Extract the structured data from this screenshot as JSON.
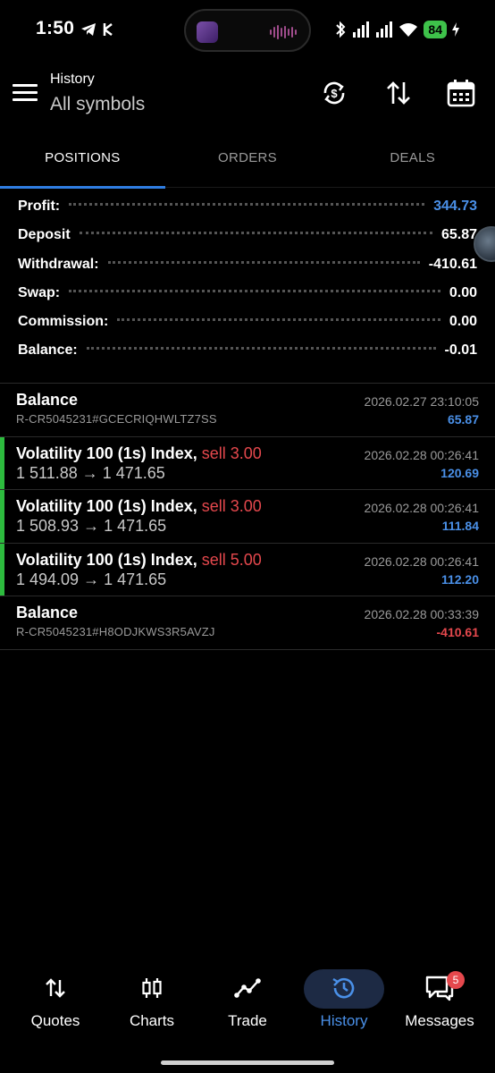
{
  "status_bar": {
    "time": "1:50",
    "battery": "84",
    "icons": [
      "telegram-icon",
      "app-notification-icon",
      "bluetooth-icon",
      "signal-icon",
      "signal-icon",
      "wifi-icon",
      "charging-icon"
    ]
  },
  "header": {
    "title": "History",
    "subtitle": "All symbols",
    "actions": [
      "currency-refresh-icon",
      "sort-icon",
      "calendar-icon"
    ]
  },
  "tabs": [
    {
      "label": "POSITIONS",
      "active": true
    },
    {
      "label": "ORDERS",
      "active": false
    },
    {
      "label": "DEALS",
      "active": false
    }
  ],
  "summary": [
    {
      "label": "Profit:",
      "value": "344.73",
      "color": "#4a90e8"
    },
    {
      "label": "Deposit",
      "value": "65.87",
      "color": "#ffffff"
    },
    {
      "label": "Withdrawal:",
      "value": "-410.61",
      "color": "#ffffff"
    },
    {
      "label": "Swap:",
      "value": "0.00",
      "color": "#ffffff"
    },
    {
      "label": "Commission:",
      "value": "0.00",
      "color": "#ffffff"
    },
    {
      "label": "Balance:",
      "value": "-0.01",
      "color": "#ffffff"
    }
  ],
  "history": [
    {
      "type": "balance",
      "title": "Balance",
      "sub": "R-CR5045231#GCECRIQHWLTZ7SS",
      "date": "2026.02.27 23:10:05",
      "amount": "65.87",
      "amount_color": "#4a90e8"
    },
    {
      "type": "position",
      "symbol": "Volatility 100 (1s) Index,",
      "side": "sell 3.00",
      "prices": "1 511.88 → 1 471.65",
      "date": "2026.02.28 00:26:41",
      "amount": "120.69",
      "amount_color": "#4a90e8"
    },
    {
      "type": "position",
      "symbol": "Volatility 100 (1s) Index,",
      "side": "sell 3.00",
      "prices": "1 508.93 → 1 471.65",
      "date": "2026.02.28 00:26:41",
      "amount": "111.84",
      "amount_color": "#4a90e8"
    },
    {
      "type": "position",
      "symbol": "Volatility 100 (1s) Index,",
      "side": "sell 5.00",
      "prices": "1 494.09 → 1 471.65",
      "date": "2026.02.28 00:26:41",
      "amount": "112.20",
      "amount_color": "#4a90e8"
    },
    {
      "type": "balance",
      "title": "Balance",
      "sub": "R-CR5045231#H8ODJKWS3R5AVZJ",
      "date": "2026.02.28 00:33:39",
      "amount": "-410.61",
      "amount_color": "#e5484d"
    }
  ],
  "bottom_nav": [
    {
      "label": "Quotes",
      "icon": "quotes-arrows-icon",
      "active": false
    },
    {
      "label": "Charts",
      "icon": "candlestick-icon",
      "active": false
    },
    {
      "label": "Trade",
      "icon": "trend-line-icon",
      "active": false
    },
    {
      "label": "History",
      "icon": "history-clock-icon",
      "active": true
    },
    {
      "label": "Messages",
      "icon": "messages-icon",
      "active": false,
      "badge": "5"
    }
  ]
}
